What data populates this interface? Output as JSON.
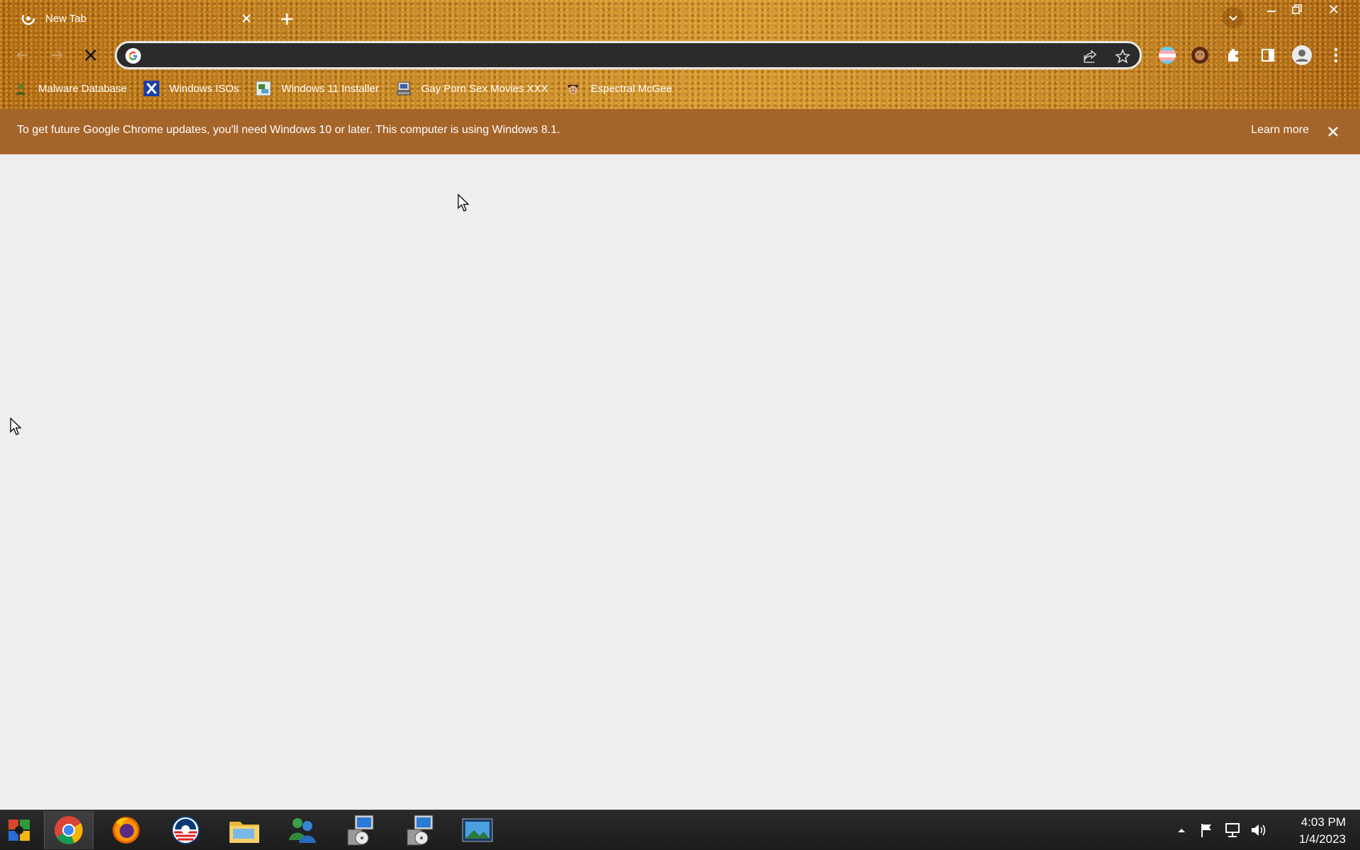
{
  "tab": {
    "title": "New Tab"
  },
  "omnibox": {
    "value": "",
    "placeholder": ""
  },
  "bookmarks": [
    {
      "label": "Malware Database",
      "icon": "malware-database-icon"
    },
    {
      "label": "Windows ISOs",
      "icon": "windows-isos-icon"
    },
    {
      "label": "Windows 11 Installer",
      "icon": "windows-11-installer-icon"
    },
    {
      "label": "Gay Porn Sex Movies XXX",
      "icon": "computer-icon"
    },
    {
      "label": "Espectral McGee",
      "icon": "face-icon"
    }
  ],
  "infobar": {
    "message": "To get future Google Chrome updates, you'll need Windows 10 or later. This computer is using Windows 8.1.",
    "learn_more": "Learn more"
  },
  "clock": {
    "time": "4:03 PM",
    "date": "1/4/2023"
  },
  "colors": {
    "infobar": "#a5642a",
    "omnibox": "#2b2b2b",
    "page": "#eeeeee",
    "taskbar": "#1c1c1c"
  }
}
